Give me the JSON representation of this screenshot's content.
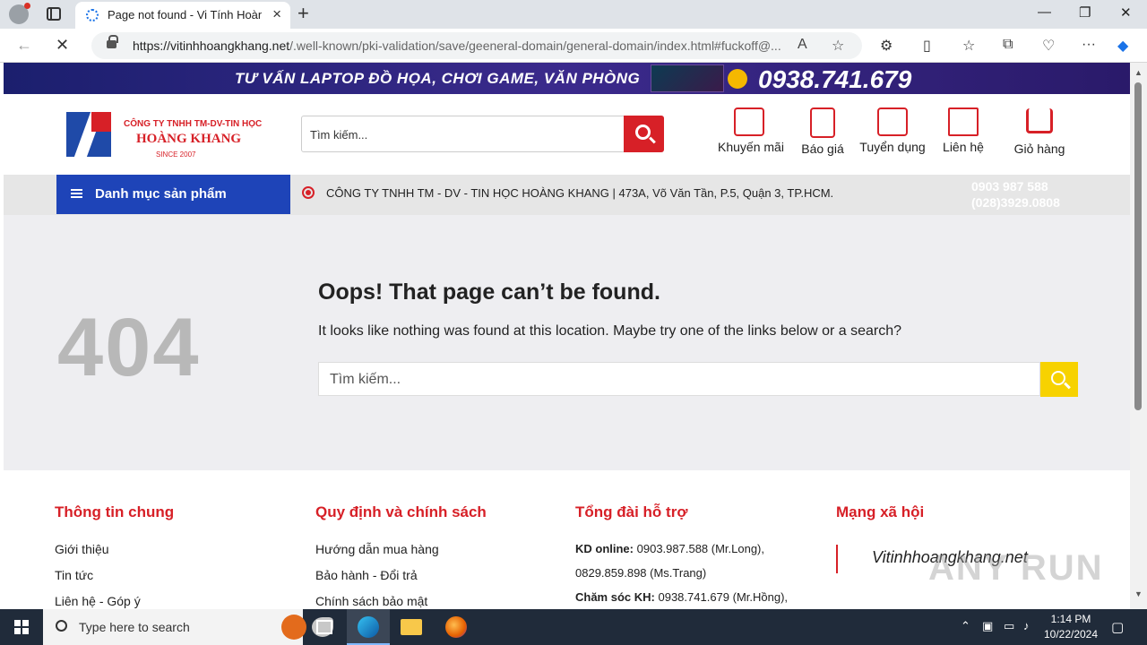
{
  "browser": {
    "tab_title": "Page not found - Vi Tính Hoàng",
    "url_domain": "https://vitinhhoangkhang.net",
    "url_path": "/.well-known/pki-validation/save/geeneral-domain/general-domain/index.html#fuckoff@..."
  },
  "banner": {
    "text": "TƯ VẤN LAPTOP ĐỒ HỌA, CHƠI GAME, VĂN PHÒNG",
    "phone": "0938.741.679"
  },
  "logo": {
    "subtitle": "CÔNG TY TNHH TM-DV-TIN HỌC",
    "name": "HOÀNG KHANG",
    "since": "SINCE 2007"
  },
  "header": {
    "search_placeholder": "Tìm kiếm...",
    "links": [
      "Khuyến mãi",
      "Báo giá",
      "Tuyển dụng",
      "Liên hệ",
      "Giỏ hàng"
    ]
  },
  "navbar": {
    "category_label": "Danh mục sản phẩm",
    "marquee": "CÔNG TY TNHH TM - DV - TIN HỌC HOÀNG KHANG | 473A, Võ Văn Tần, P.5, Quận 3, TP.HCM.",
    "hotline1": "0903 987 588",
    "hotline2": "(028)3929.0808"
  },
  "error": {
    "code": "404",
    "title": "Oops! That page can’t be found.",
    "description": "It looks like nothing was found at this location. Maybe try one of the links below or a search?",
    "search_placeholder": "Tìm kiếm..."
  },
  "footer": {
    "col1": {
      "title": "Thông tin chung",
      "links": [
        "Giới thiệu",
        "Tin tức",
        "Liên hệ - Góp ý"
      ]
    },
    "col2": {
      "title": "Quy định và chính sách",
      "links": [
        "Hướng dẫn mua hàng",
        "Bảo hành - Đổi trả",
        "Chính sách bảo mật"
      ]
    },
    "col3": {
      "title": "Tổng đài hỗ trợ",
      "kd_label": "KD online:",
      "kd_value": "0903.987.588 (Mr.Long),",
      "kd_value2": "0829.859.898 (Ms.Trang)",
      "cs_label": "Chăm sóc KH:",
      "cs_value": "0938.741.679 (Mr.Hồng),"
    },
    "col4": {
      "title": "Mạng xã hội",
      "social": "Vitinhhoangkhang.net"
    }
  },
  "watermark": "ANY RUN",
  "taskbar": {
    "search_placeholder": "Type here to search",
    "time": "1:14 PM",
    "date": "10/22/2024"
  },
  "colors": {
    "brand_red": "#d72027",
    "brand_blue": "#1e44b8",
    "search_yellow": "#f7d200"
  }
}
